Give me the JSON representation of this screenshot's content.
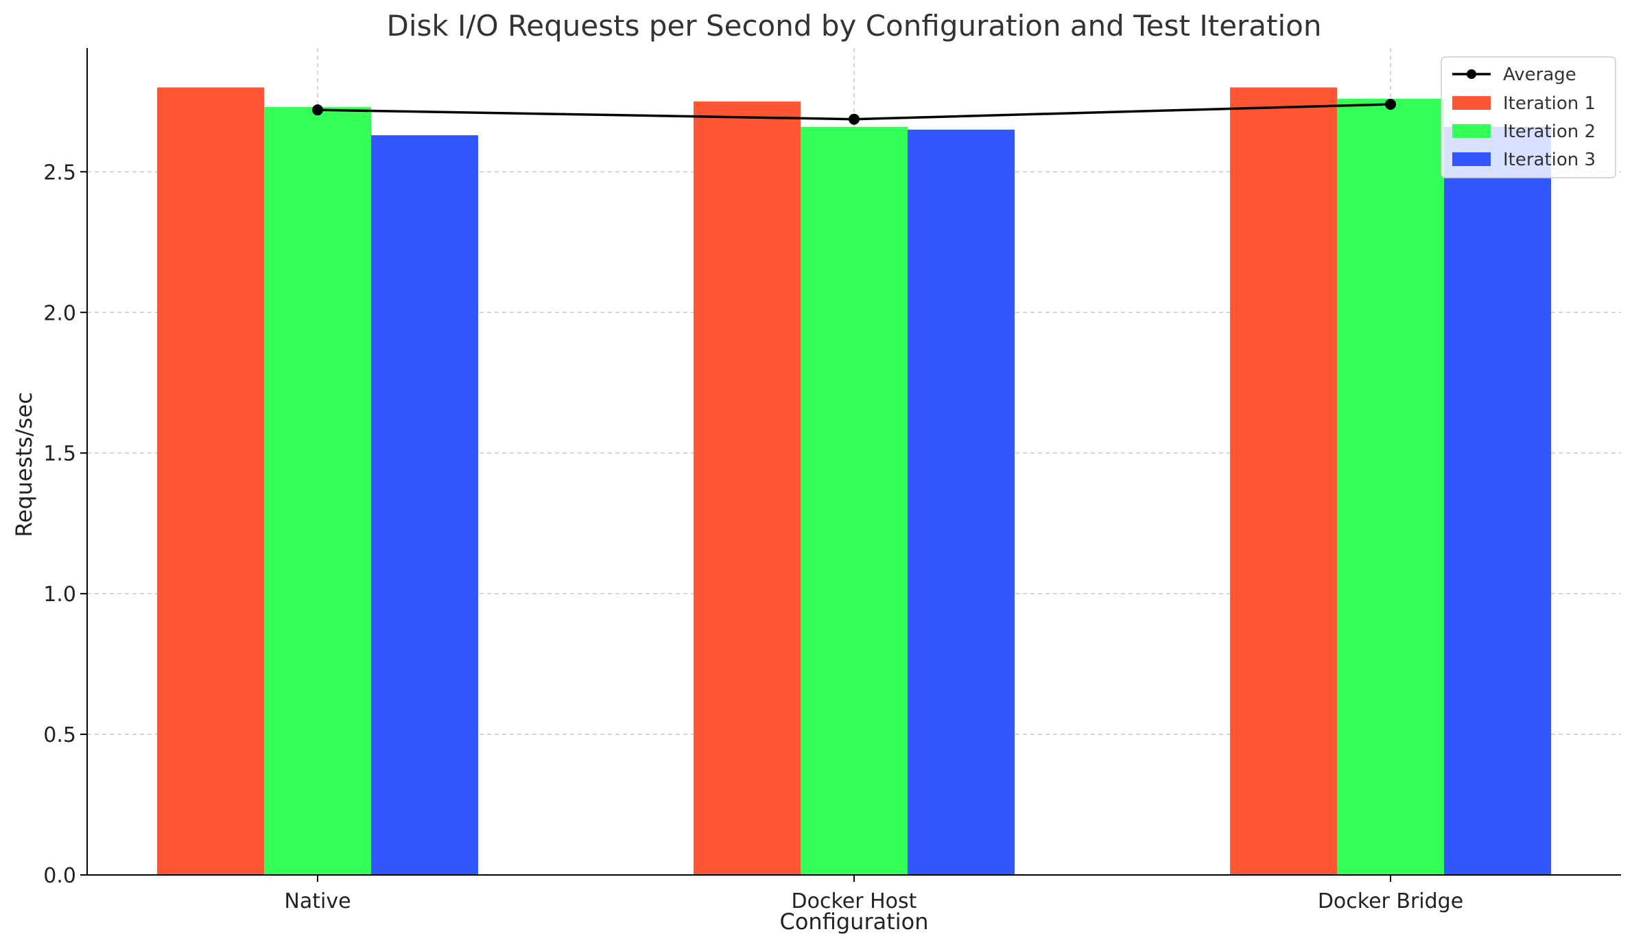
{
  "chart_data": {
    "type": "bar",
    "title": "Disk I/O Requests per Second by Configuration and Test Iteration",
    "xlabel": "Configuration",
    "ylabel": "Requests/sec",
    "categories": [
      "Native",
      "Docker Host",
      "Docker Bridge"
    ],
    "series": [
      {
        "name": "Iteration 1",
        "color": "#ff5733",
        "values": [
          2.8,
          2.75,
          2.8
        ]
      },
      {
        "name": "Iteration 2",
        "color": "#33ff57",
        "values": [
          2.73,
          2.66,
          2.76
        ]
      },
      {
        "name": "Iteration 3",
        "color": "#3357ff",
        "values": [
          2.63,
          2.65,
          2.66
        ]
      }
    ],
    "line_series": {
      "name": "Average",
      "color": "#000000",
      "type": "line",
      "marker": "circle",
      "values": [
        2.72,
        2.687,
        2.74
      ]
    },
    "ylim": [
      0,
      2.94
    ],
    "yticks": [
      "0.0",
      "0.5",
      "1.0",
      "1.5",
      "2.0",
      "2.5"
    ],
    "grid": true,
    "legend_position": "top-right",
    "legend_order": [
      "Average",
      "Iteration 1",
      "Iteration 2",
      "Iteration 3"
    ]
  }
}
